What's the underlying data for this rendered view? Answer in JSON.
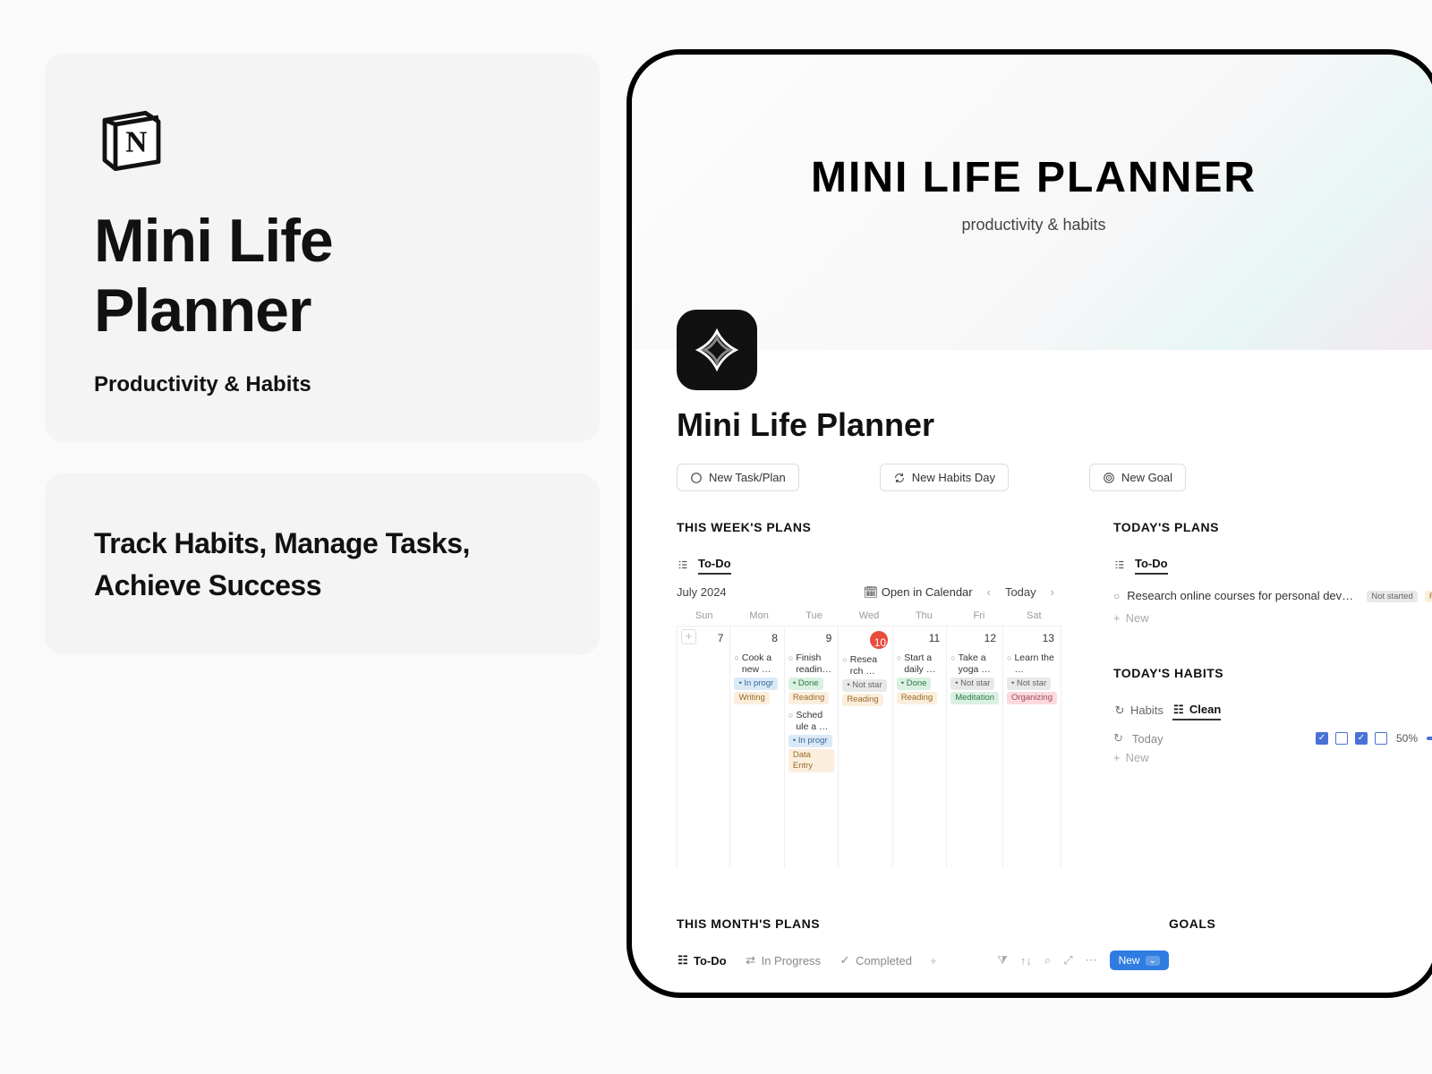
{
  "left": {
    "title": "Mini Life Planner",
    "subtitle": "Productivity & Habits",
    "tagline": "Track Habits, Manage Tasks, Achieve Success"
  },
  "cover": {
    "title": "MINI LIFE PLANNER",
    "subtitle": "productivity & habits"
  },
  "page": {
    "title": "Mini Life Planner"
  },
  "buttons": {
    "new_task": "New Task/Plan",
    "new_habits": "New Habits Day",
    "new_goal": "New Goal"
  },
  "week": {
    "title": "THIS WEEK'S PLANS",
    "view_tab": "To-Do",
    "month_label": "July 2024",
    "open_calendar": "Open in Calendar",
    "today_label": "Today",
    "day_names": [
      "Sun",
      "Mon",
      "Tue",
      "Wed",
      "Thu",
      "Fri",
      "Sat"
    ],
    "day_nums": [
      "7",
      "8",
      "9",
      "10",
      "11",
      "12",
      "13"
    ],
    "today_index": 3,
    "events": {
      "mon": {
        "title": "Cook a new …",
        "status": "In progr",
        "status_class": "p-prog",
        "tag": "Writing",
        "tag_class": "p-write"
      },
      "tue1": {
        "title": "Finish readin…",
        "status": "Done",
        "status_class": "p-done",
        "tag": "Reading",
        "tag_class": "p-read"
      },
      "tue2": {
        "title": "Sched ule a …",
        "status": "In progr",
        "status_class": "p-prog",
        "tag": "Data Entry",
        "tag_class": "p-data"
      },
      "wed": {
        "title": "Resea rch …",
        "status": "Not star",
        "status_class": "p-nots",
        "tag": "Reading",
        "tag_class": "p-read"
      },
      "thu": {
        "title": "Start a daily …",
        "status": "Done",
        "status_class": "p-done",
        "tag": "Reading",
        "tag_class": "p-read"
      },
      "fri": {
        "title": "Take a yoga …",
        "status": "Not star",
        "status_class": "p-nots",
        "tag": "Meditation",
        "tag_class": "p-med"
      },
      "sat": {
        "title": "Learn the …",
        "status": "Not star",
        "status_class": "p-nots",
        "tag": "Organizing",
        "tag_class": "p-org"
      }
    }
  },
  "todays_plans": {
    "title": "TODAY'S PLANS",
    "tab": "To-Do",
    "task": "Research online courses for personal develop…",
    "status": "Not started",
    "status_class": "p-nots",
    "tag2": "Re",
    "tag2_class": "p-read",
    "new": "New"
  },
  "todays_habits": {
    "title": "TODAY'S HABITS",
    "tab1": "Habits",
    "tab2": "Clean",
    "row_label": "Today",
    "pct": "50%",
    "new": "New",
    "checks": [
      true,
      false,
      true,
      false
    ]
  },
  "month": {
    "title": "THIS MONTH'S PLANS",
    "tabs": {
      "todo": "To-Do",
      "inprog": "In Progress",
      "completed": "Completed"
    },
    "newbtn": "New"
  },
  "goals": {
    "title": "GOALS"
  }
}
